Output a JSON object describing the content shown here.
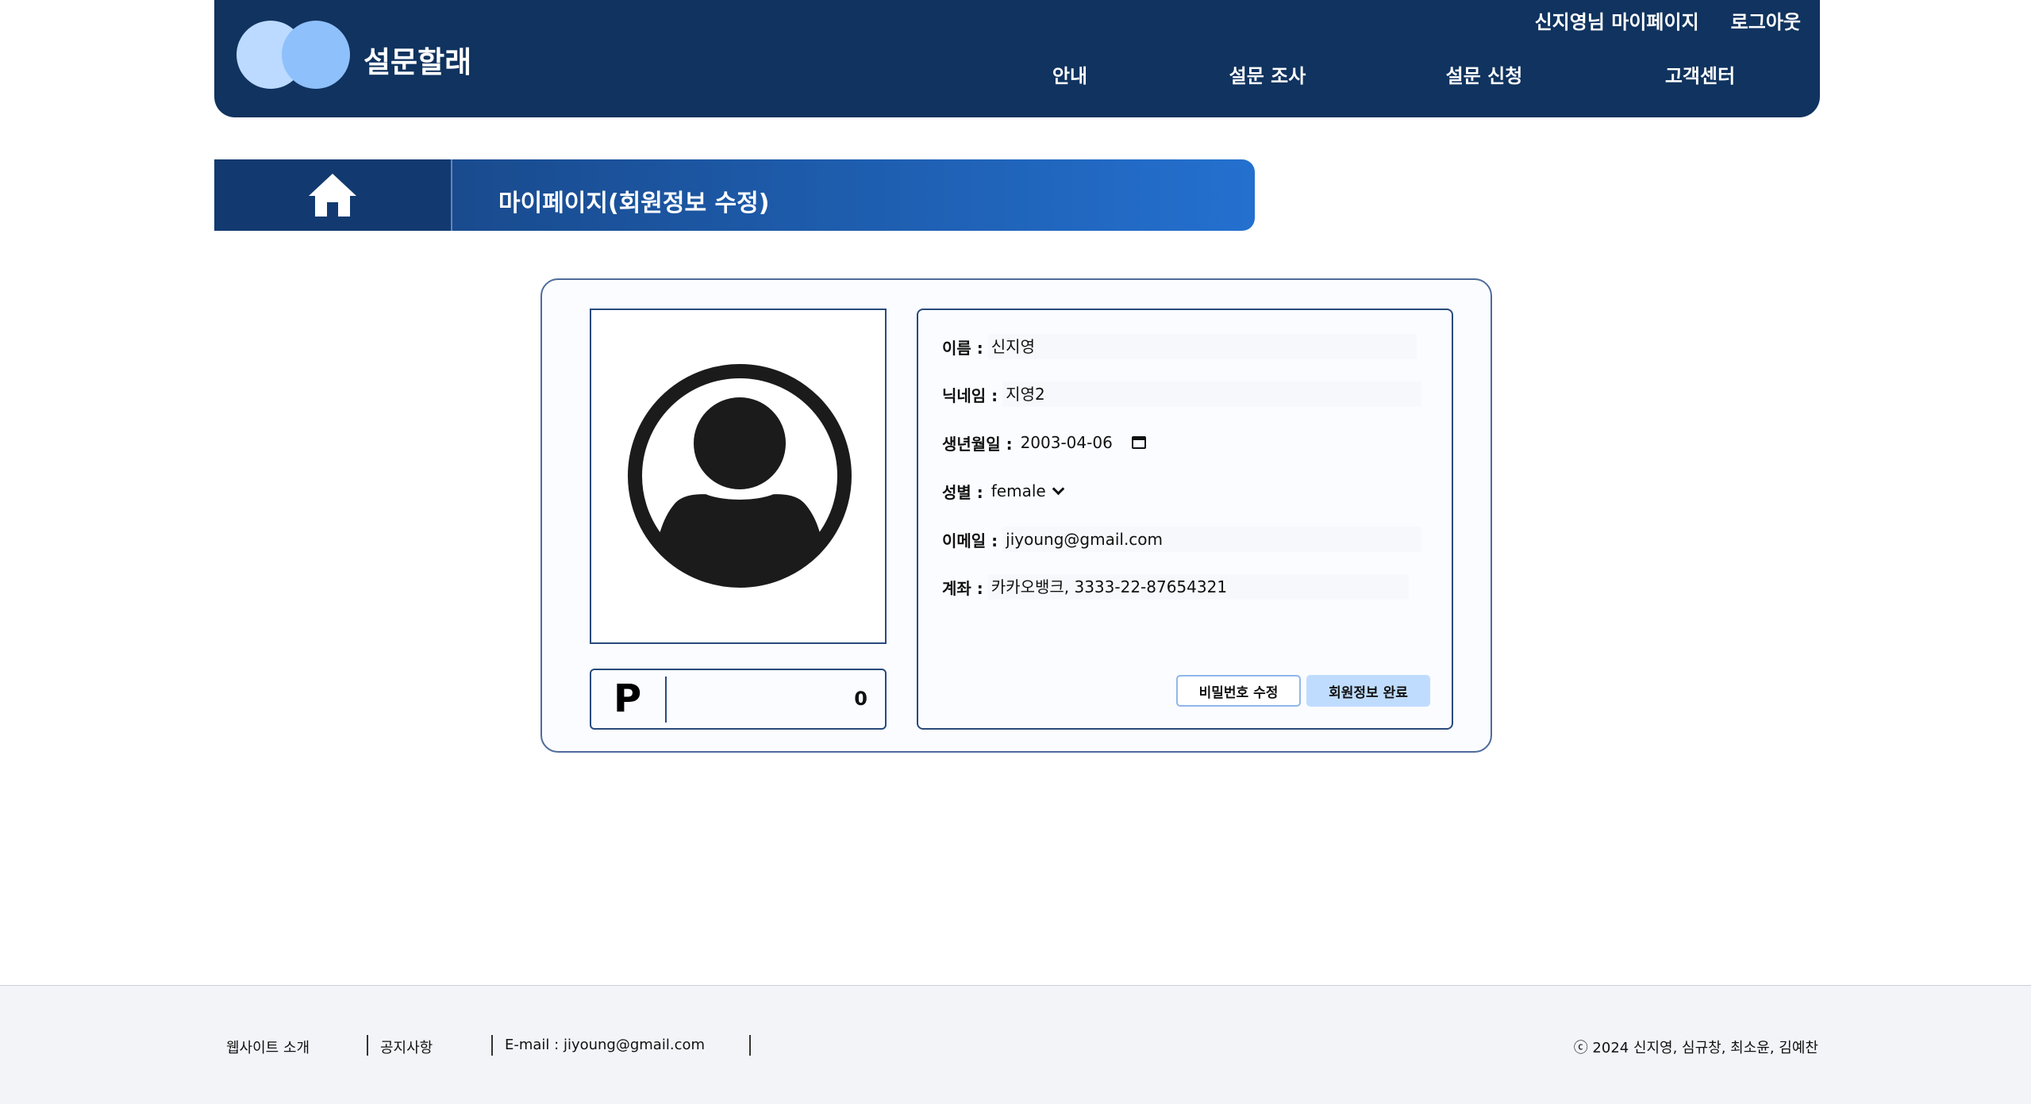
{
  "header": {
    "brand": "설문할래",
    "mypage_link": "신지영님 마이페이지",
    "logout": "로그아웃",
    "nav": [
      "안내",
      "설문 조사",
      "설문 신청",
      "고객센터"
    ]
  },
  "titlebar": {
    "title": "마이페이지(회원정보 수정)"
  },
  "profile": {
    "points_icon": "P",
    "points": "0",
    "fields": {
      "name": {
        "label": "이름 :",
        "value": "신지영"
      },
      "nickname": {
        "label": "닉네임 :",
        "value": "지영2"
      },
      "birthdate": {
        "label": "생년월일 :",
        "value": "2003-04-06"
      },
      "gender": {
        "label": "성별 :",
        "value": "female"
      },
      "email": {
        "label": "이메일 :",
        "value": "jiyoung@gmail.com"
      },
      "account": {
        "label": "계좌 :",
        "value": "카카오뱅크, 3333-22-87654321"
      }
    },
    "buttons": {
      "change_password": "비밀번호 수정",
      "save": "회원정보 완료"
    }
  },
  "footer": {
    "about": "웹사이트 소개",
    "notice": "공지사항",
    "email": "E-mail : jiyoung@gmail.com",
    "copyright": "ⓒ 2024 신지영, 심규창, 최소윤, 김예찬"
  },
  "colors": {
    "header_bg": "#10335f",
    "accent": "#2470cf",
    "save_button": "#bfdcff"
  }
}
